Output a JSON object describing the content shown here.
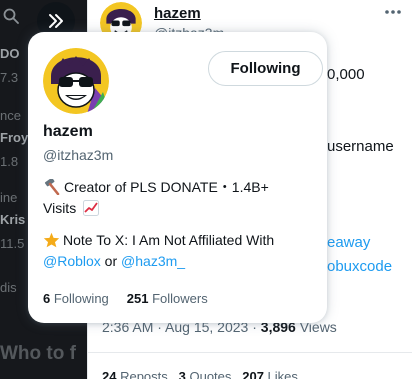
{
  "colors": {
    "accent": "#1d9bf0",
    "text": "#0f1419",
    "muted": "#536471",
    "border": "#cfd9de",
    "dark_bg": "#16181c"
  },
  "icons": [
    "search-icon",
    "double-chevron-right-icon",
    "more-options-icon",
    "hammer-icon",
    "chart-increasing-icon",
    "star-icon"
  ],
  "left_panel": {
    "fragments": [
      "DO",
      "7.3",
      "nce",
      "Froy",
      "1.8",
      "Kris",
      "11.5",
      "dis",
      "ine"
    ],
    "section_title": "Who to f"
  },
  "tweet": {
    "author_name": "hazem",
    "author_handle": "@itzhaz3m",
    "peek_fragments": [
      "0,000",
      "username",
      "eaway",
      "obuxcode"
    ],
    "timestamp": "2:36 AM · Aug 15, 2023 · ",
    "views_count": "3,896",
    "views_label": " Views",
    "stats_peek": {
      "reposts_count": "24",
      "reposts_label": " Reposts",
      "quotes_count": "3",
      "quotes_label": " Quotes",
      "likes_count": "207",
      "likes_label": " Likes"
    }
  },
  "hover_card": {
    "name": "hazem",
    "handle": "@itzhaz3m",
    "follow_button": "Following",
    "bio_line1": "Creator of PLS DONATE・1.4B+",
    "bio_line2": "Visits",
    "bio_line3": "Note To X: I Am Not Affiliated With",
    "mention1": "@Roblox",
    "bio_or": " or ",
    "mention2": "@haz3m_",
    "following_count": "6",
    "following_label": "Following",
    "followers_count": "251",
    "followers_label": "Followers"
  }
}
